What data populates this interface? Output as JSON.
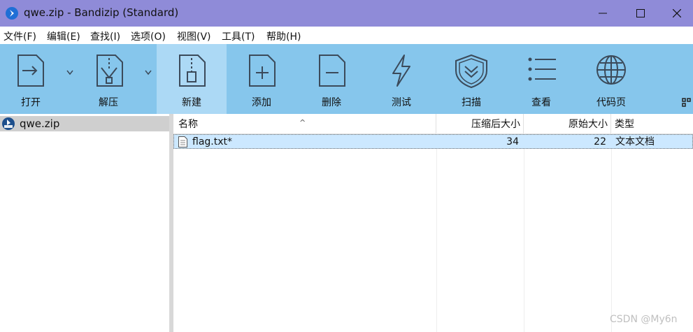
{
  "window": {
    "title": "qwe.zip - Bandizip (Standard)"
  },
  "menu": [
    "文件(F)",
    "编辑(E)",
    "查找(I)",
    "选项(O)",
    "视图(V)",
    "工具(T)",
    "帮助(H)"
  ],
  "toolbar": {
    "open": "打开",
    "extract": "解压",
    "new": "新建",
    "add": "添加",
    "delete": "删除",
    "test": "测试",
    "scan": "扫描",
    "view": "查看",
    "codepage": "代码页"
  },
  "tree": {
    "archive": "qwe.zip"
  },
  "columns": {
    "name": "名称",
    "compressed": "压缩后大小",
    "original": "原始大小",
    "type": "类型"
  },
  "files": [
    {
      "name": "flag.txt*",
      "compressed": "34",
      "original": "22",
      "type": "文本文档"
    }
  ],
  "watermark": "CSDN @My6n"
}
